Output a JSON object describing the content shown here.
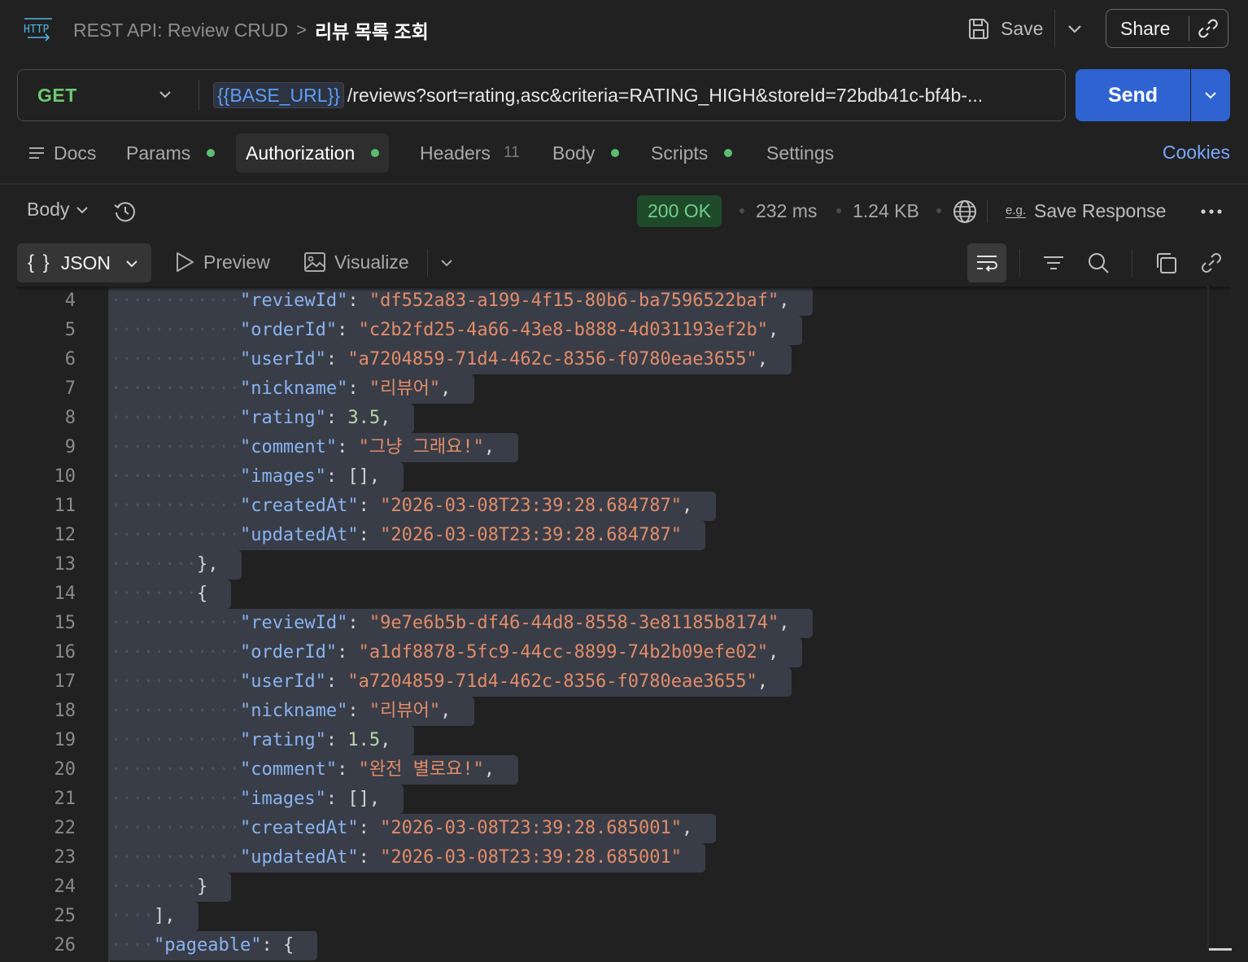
{
  "header": {
    "protocol_icon": "http-icon",
    "breadcrumb_parent": "REST API: Review CRUD",
    "breadcrumb_separator": ">",
    "breadcrumb_current": "리뷰 목록 조회",
    "save_label": "Save",
    "share_label": "Share"
  },
  "request": {
    "method": "GET",
    "url_variable": "{{BASE_URL}}",
    "url_path": "/reviews?sort=rating,asc&criteria=RATING_HIGH&storeId=72bdb41c-bf4b-...",
    "send_label": "Send"
  },
  "request_tabs": [
    {
      "label": "Docs",
      "dot": false
    },
    {
      "label": "Params",
      "dot": true
    },
    {
      "label": "Authorization",
      "dot": true,
      "active": true
    },
    {
      "label": "Headers",
      "count": "11"
    },
    {
      "label": "Body",
      "dot": true
    },
    {
      "label": "Scripts",
      "dot": true
    },
    {
      "label": "Settings",
      "dot": false
    }
  ],
  "cookies_label": "Cookies",
  "response": {
    "view_label": "Body",
    "status": "200 OK",
    "time": "232 ms",
    "size": "1.24 KB",
    "save_response_label": "Save Response",
    "eg_label": "e.g."
  },
  "viewer": {
    "format_label": "JSON",
    "format_braces": "{ }",
    "preview_label": "Preview",
    "visualize_label": "Visualize"
  },
  "colors": {
    "accent": "#2f63d1",
    "method_get": "#6cc96f",
    "status_ok": "#6fd08a",
    "json_key": "#89b3f0",
    "json_string": "#e28c69",
    "json_number": "#b9d7a8",
    "link": "#7aa7ff"
  },
  "code_lines": [
    {
      "n": "4",
      "indent": 3,
      "key": "reviewId",
      "val": "\"df552a83-a199-4f15-80b6-ba7596522baf\"",
      "vt": "s",
      "tail": ","
    },
    {
      "n": "5",
      "indent": 3,
      "key": "orderId",
      "val": "\"c2b2fd25-4a66-43e8-b888-4d031193ef2b\"",
      "vt": "s",
      "tail": ","
    },
    {
      "n": "6",
      "indent": 3,
      "key": "userId",
      "val": "\"a7204859-71d4-462c-8356-f0780eae3655\"",
      "vt": "s",
      "tail": ","
    },
    {
      "n": "7",
      "indent": 3,
      "key": "nickname",
      "val": "\"리뷰어\"",
      "vt": "s",
      "tail": ","
    },
    {
      "n": "8",
      "indent": 3,
      "key": "rating",
      "val": "3.5",
      "vt": "n",
      "tail": ","
    },
    {
      "n": "9",
      "indent": 3,
      "key": "comment",
      "val": "\"그냥 그래요!\"",
      "vt": "s",
      "tail": ","
    },
    {
      "n": "10",
      "indent": 3,
      "key": "images",
      "val": "[]",
      "vt": "p",
      "tail": ","
    },
    {
      "n": "11",
      "indent": 3,
      "key": "createdAt",
      "val": "\"2026-03-08T23:39:28.684787\"",
      "vt": "s",
      "tail": ","
    },
    {
      "n": "12",
      "indent": 3,
      "key": "updatedAt",
      "val": "\"2026-03-08T23:39:28.684787\"",
      "vt": "s",
      "tail": ""
    },
    {
      "n": "13",
      "indent": 2,
      "key": "",
      "val": "},",
      "vt": "p",
      "tail": ""
    },
    {
      "n": "14",
      "indent": 2,
      "key": "",
      "val": "{",
      "vt": "p",
      "tail": ""
    },
    {
      "n": "15",
      "indent": 3,
      "key": "reviewId",
      "val": "\"9e7e6b5b-df46-44d8-8558-3e81185b8174\"",
      "vt": "s",
      "tail": ","
    },
    {
      "n": "16",
      "indent": 3,
      "key": "orderId",
      "val": "\"a1df8878-5fc9-44cc-8899-74b2b09efe02\"",
      "vt": "s",
      "tail": ","
    },
    {
      "n": "17",
      "indent": 3,
      "key": "userId",
      "val": "\"a7204859-71d4-462c-8356-f0780eae3655\"",
      "vt": "s",
      "tail": ","
    },
    {
      "n": "18",
      "indent": 3,
      "key": "nickname",
      "val": "\"리뷰어\"",
      "vt": "s",
      "tail": ","
    },
    {
      "n": "19",
      "indent": 3,
      "key": "rating",
      "val": "1.5",
      "vt": "n",
      "tail": ","
    },
    {
      "n": "20",
      "indent": 3,
      "key": "comment",
      "val": "\"완전 별로요!\"",
      "vt": "s",
      "tail": ","
    },
    {
      "n": "21",
      "indent": 3,
      "key": "images",
      "val": "[]",
      "vt": "p",
      "tail": ","
    },
    {
      "n": "22",
      "indent": 3,
      "key": "createdAt",
      "val": "\"2026-03-08T23:39:28.685001\"",
      "vt": "s",
      "tail": ","
    },
    {
      "n": "23",
      "indent": 3,
      "key": "updatedAt",
      "val": "\"2026-03-08T23:39:28.685001\"",
      "vt": "s",
      "tail": ""
    },
    {
      "n": "24",
      "indent": 2,
      "key": "",
      "val": "}",
      "vt": "p",
      "tail": ""
    },
    {
      "n": "25",
      "indent": 1,
      "key": "",
      "val": "],",
      "vt": "p",
      "tail": ""
    },
    {
      "n": "26",
      "indent": 1,
      "key": "pageable",
      "val": "{",
      "vt": "p",
      "tail": ""
    }
  ]
}
